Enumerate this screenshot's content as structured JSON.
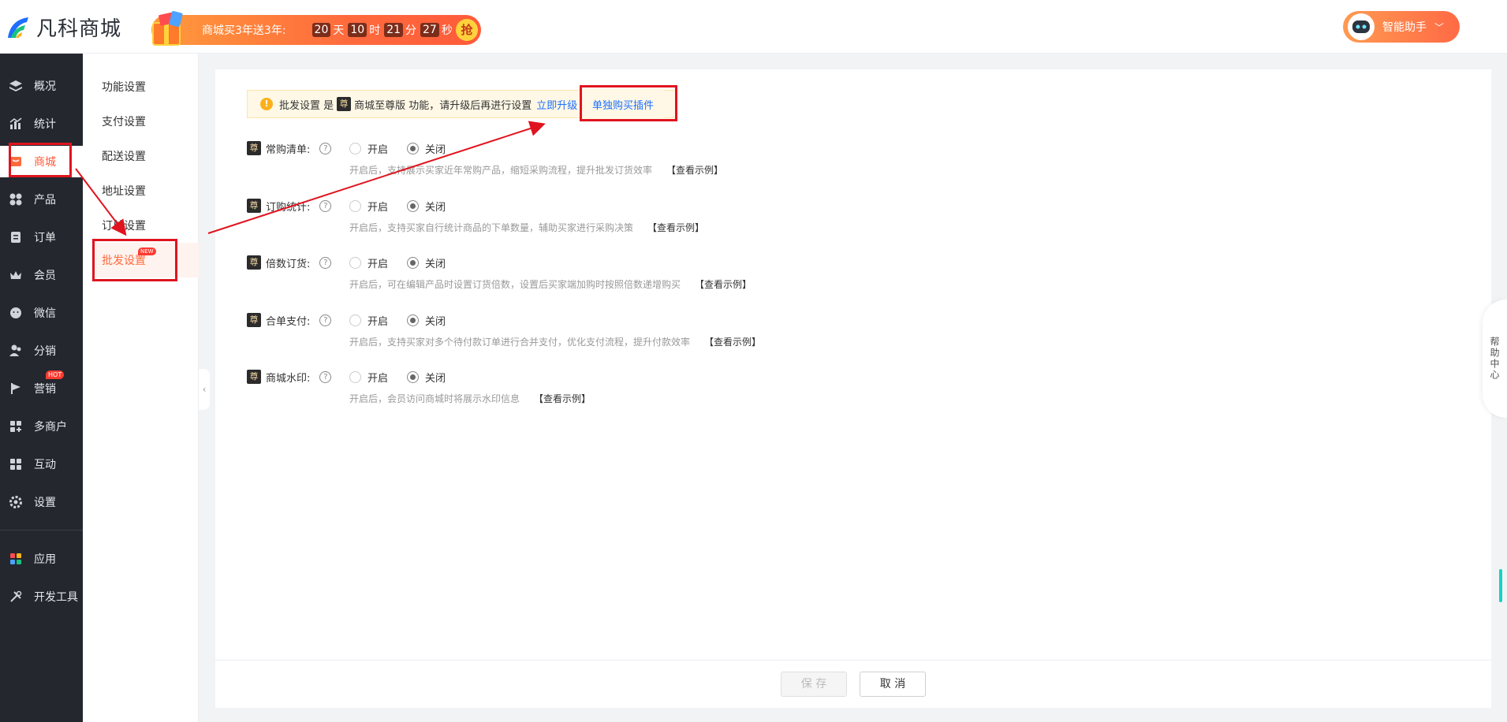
{
  "header": {
    "logo_text": "凡科商城",
    "promo": {
      "text": "商城买3年送3年:",
      "days": "20",
      "days_unit": "天",
      "hours": "10",
      "hours_unit": "时",
      "minutes": "21",
      "minutes_unit": "分",
      "seconds": "27",
      "seconds_unit": "秒",
      "cta": "抢"
    },
    "assistant_label": "智能助手"
  },
  "leftnav": {
    "items": [
      {
        "label": "概况",
        "icon": "layers-icon"
      },
      {
        "label": "统计",
        "icon": "chart-icon"
      },
      {
        "label": "商城",
        "icon": "shop-icon"
      },
      {
        "label": "产品",
        "icon": "product-icon"
      },
      {
        "label": "订单",
        "icon": "order-icon"
      },
      {
        "label": "会员",
        "icon": "crown-icon"
      },
      {
        "label": "微信",
        "icon": "wechat-icon"
      },
      {
        "label": "分销",
        "icon": "distribution-icon"
      },
      {
        "label": "营销",
        "icon": "flag-icon",
        "badge": "HOT"
      },
      {
        "label": "多商户",
        "icon": "multi-merchant-icon"
      },
      {
        "label": "互动",
        "icon": "interact-icon"
      },
      {
        "label": "设置",
        "icon": "gear-icon"
      },
      {
        "label": "应用",
        "icon": "apps-icon"
      },
      {
        "label": "开发工具",
        "icon": "tools-icon"
      }
    ]
  },
  "subnav": {
    "items": [
      {
        "label": "功能设置"
      },
      {
        "label": "支付设置"
      },
      {
        "label": "配送设置"
      },
      {
        "label": "地址设置"
      },
      {
        "label": "订单设置"
      },
      {
        "label": "批发设置",
        "badge": "NEW"
      }
    ]
  },
  "notice": {
    "prefix": "批发设置 是",
    "vip": "尊",
    "suffix": "商城至尊版 功能，请升级后再进行设置",
    "upgrade_link": "立即升级",
    "buy_plugin": "单独购买插件"
  },
  "settings": [
    {
      "vip": "尊",
      "label": "常购清单:",
      "on": "开启",
      "off": "关闭",
      "desc": "开启后，支持展示买家近年常购产品，缩短采购流程，提升批发订货效率",
      "example": "【查看示例】"
    },
    {
      "vip": "尊",
      "label": "订购统计:",
      "on": "开启",
      "off": "关闭",
      "desc": "开启后，支持买家自行统计商品的下单数量，辅助买家进行采购决策",
      "example": "【查看示例】"
    },
    {
      "vip": "尊",
      "label": "倍数订货:",
      "on": "开启",
      "off": "关闭",
      "desc": "开启后，可在编辑产品时设置订货倍数，设置后买家端加购时按照倍数递增购买",
      "example": "【查看示例】"
    },
    {
      "vip": "尊",
      "label": "合单支付:",
      "on": "开启",
      "off": "关闭",
      "desc": "开启后，支持买家对多个待付款订单进行合并支付，优化支付流程，提升付款效率",
      "example": "【查看示例】"
    },
    {
      "vip": "尊",
      "label": "商城水印:",
      "on": "开启",
      "off": "关闭",
      "desc": "开启后，会员访问商城时将展示水印信息",
      "example": "【查看示例】"
    }
  ],
  "footer": {
    "save": "保 存",
    "cancel": "取 消"
  },
  "help_center": "帮助中心",
  "colors": {
    "accent": "#ff6a3d",
    "annotation": "#e0141e",
    "link": "#1e6fff"
  }
}
